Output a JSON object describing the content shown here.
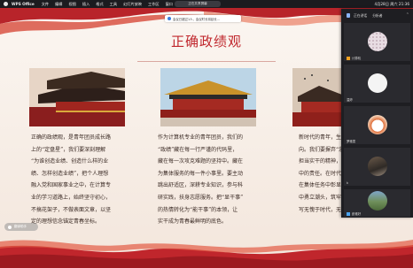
{
  "menubar": {
    "app_name": "WPS Office",
    "items": [
      "文件",
      "编辑",
      "视图",
      "插入",
      "格式",
      "工具",
      "幻灯片放映",
      "工作区",
      "窗口",
      "帮助"
    ],
    "right_items": [
      "4月28日 周六 21:36"
    ]
  },
  "center_pill": "正在共享屏幕",
  "toast": "会议已超过1人，会议时长将延长...",
  "slide": {
    "title": "正确政绩观",
    "columns": [
      {
        "lines": [
          "正确的政绩观，是青年团员成长路",
          "上的“定盘星”，我们要深刻理解",
          "“为谁创造业绩、创造什么样的业",
          "绩、怎样创造业绩”，把个人理想",
          "融入党和国家事业之中，在计算专",
          "业的学习道路上，始终坚守初心，",
          "不搞花架子，不做表面文章，以坚",
          "定的理想信念锚定青春坐标。"
        ]
      },
      {
        "lines": [
          "作为计算机专业的青年团员，我们的",
          "“政绩”藏在每一行严谨的代码里，",
          "藏在每一次攻克难题的坚持中。藏在",
          "为集体服务的每一件小事里。要主动",
          "跳出舒适区，深耕专业知识，参与科",
          "研实践，扶身志愿服务。把“显干事”",
          "的热情转化为“能干事”的本领，让",
          "实干成为青春最鲜明的底色。"
        ]
      },
      {
        "lines": [
          "新时代的青年，生逢其时，",
          "向。我们要摒弃“急功近利”",
          "担当实干的精神，将个人",
          "中的责任。在时代",
          "在集体任务中彰显",
          "中勇立潮头，筑牢",
          "写无愧于时代，无"
        ]
      }
    ]
  },
  "panel": {
    "header": [
      "正在讲话",
      "分析者"
    ],
    "tiles": [
      {
        "name": "计算机",
        "avatar": "pattern-avatar"
      },
      {
        "name": "温婷",
        "avatar": "white-avatar"
      },
      {
        "name": "罗雅雯",
        "avatar": "cartoon-avatar"
      },
      {
        "name": "k",
        "avatar": "photo-avatar"
      },
      {
        "name": "彭雅好",
        "avatar": "outdoor-avatar"
      }
    ]
  },
  "chip": "翻译助手"
}
